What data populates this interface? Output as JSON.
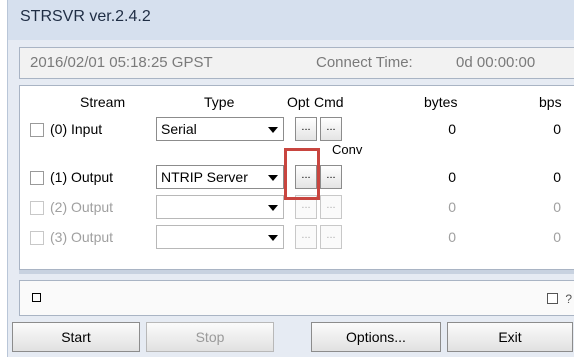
{
  "window": {
    "title": "STRSVR ver.2.4.2"
  },
  "info": {
    "datetime": "2016/02/01 05:18:25 GPST",
    "connect_label": "Connect Time:",
    "connect_value": "0d 00:00:00"
  },
  "table": {
    "headers": {
      "stream": "Stream",
      "type": "Type",
      "opt": "Opt",
      "cmd": "Cmd",
      "bytes": "bytes",
      "bps": "bps"
    },
    "conv_label": "Conv",
    "button_glyph": "...",
    "rows": [
      {
        "label": "(0) Input",
        "type": "Serial",
        "bytes": "0",
        "bps": "0",
        "enabled": true
      },
      {
        "label": "(1) Output",
        "type": "NTRIP Server",
        "bytes": "0",
        "bps": "0",
        "enabled": true
      },
      {
        "label": "(2) Output",
        "type": "",
        "bytes": "0",
        "bps": "0",
        "enabled": false
      },
      {
        "label": "(3) Output",
        "type": "",
        "bytes": "0",
        "bps": "0",
        "enabled": false
      }
    ]
  },
  "status": {
    "help": "?"
  },
  "buttons": {
    "start": "Start",
    "stop": "Stop",
    "options": "Options...",
    "exit": "Exit"
  },
  "colors": {
    "highlight": "#c8453f",
    "title_bar": "#d6e0ee"
  }
}
